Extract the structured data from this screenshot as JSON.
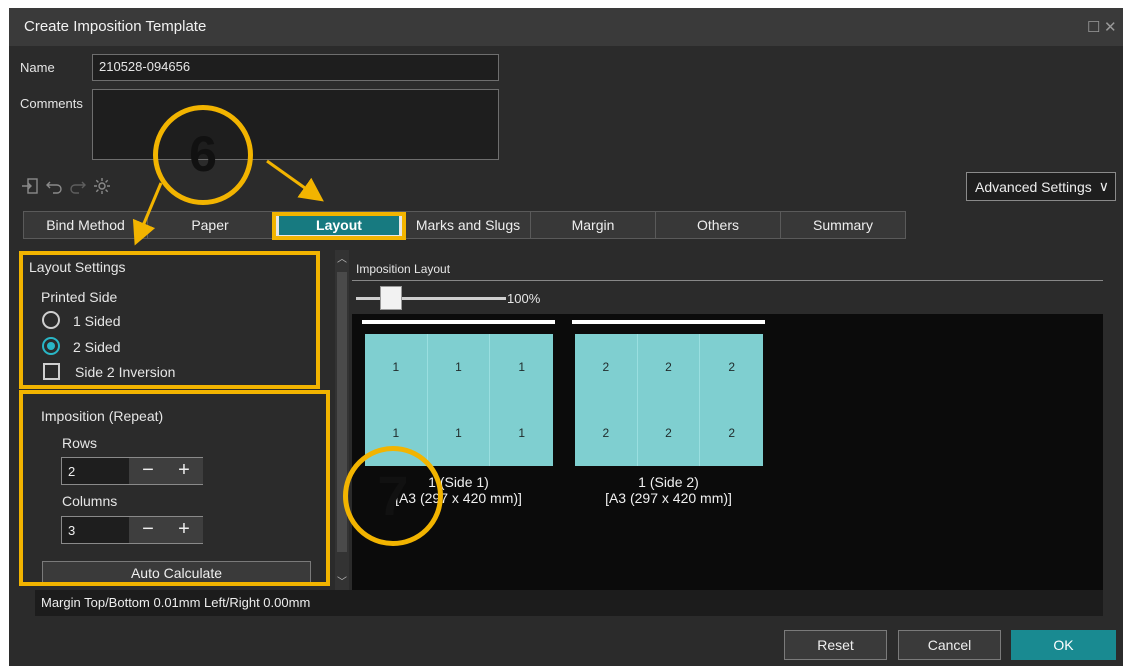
{
  "window": {
    "title": "Create Imposition Template",
    "maximize_glyph": "☐",
    "close_glyph": "✕"
  },
  "form": {
    "name_label": "Name",
    "name_value": "210528-094656",
    "comments_label": "Comments",
    "comments_value": ""
  },
  "toolbar": {
    "icons": [
      "import-icon",
      "undo-icon",
      "redo-icon",
      "settings-icon"
    ]
  },
  "advanced_settings": {
    "label": "Advanced Settings",
    "chevron": "∨"
  },
  "tabs": [
    {
      "label": "Bind Method"
    },
    {
      "label": "Paper"
    },
    {
      "label": "Layout",
      "active": true
    },
    {
      "label": "Marks and Slugs"
    },
    {
      "label": "Margin"
    },
    {
      "label": "Others"
    },
    {
      "label": "Summary"
    }
  ],
  "layout_settings": {
    "heading": "Layout Settings",
    "printed_side_label": "Printed Side",
    "options": [
      {
        "label": "1 Sided",
        "selected": false
      },
      {
        "label": "2 Sided",
        "selected": true
      }
    ],
    "side2_inversion": {
      "label": "Side 2 Inversion",
      "checked": false
    }
  },
  "imposition": {
    "heading": "Imposition (Repeat)",
    "rows_label": "Rows",
    "rows_value": "2",
    "columns_label": "Columns",
    "columns_value": "3",
    "minus": "−",
    "plus": "+",
    "auto_calculate": "Auto Calculate"
  },
  "imposition_layout": {
    "heading": "Imposition Layout",
    "zoom": "100%",
    "sheets": [
      {
        "caption_line1": "1 (Side 1)",
        "caption_line2": "[A3 (297 x 420 mm)]",
        "cells": [
          "1",
          "1",
          "1",
          "1",
          "1",
          "1"
        ]
      },
      {
        "caption_line1": "1 (Side 2)",
        "caption_line2": "[A3 (297 x 420 mm)]",
        "cells": [
          "2",
          "2",
          "2",
          "2",
          "2",
          "2"
        ]
      }
    ]
  },
  "margin_info": "Margin  Top/Bottom  0.01mm  Left/Right  0.00mm",
  "buttons": {
    "reset": "Reset",
    "cancel": "Cancel",
    "ok": "OK"
  },
  "annotations": {
    "step6": "6",
    "step7": "7",
    "color": "#f2b400"
  }
}
